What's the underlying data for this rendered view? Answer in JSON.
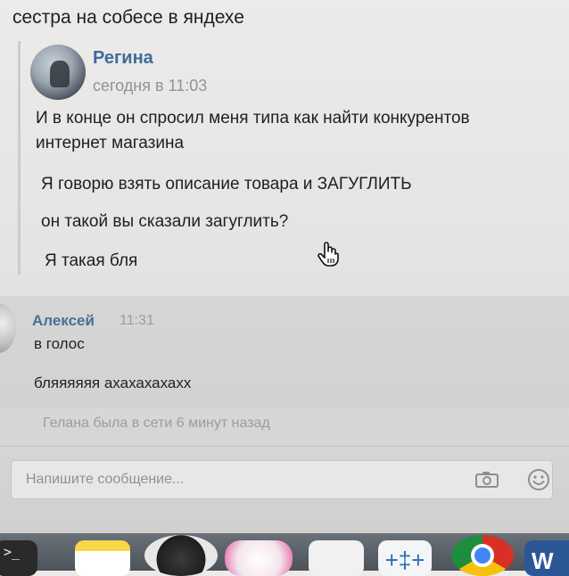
{
  "caption": "сестра на собесе в яндехе",
  "post": {
    "author": "Регина",
    "time": "сегодня в 11:03",
    "lines": [
      "И в конце он спросил меня типа как найти конкурентов",
      "интернет магазина",
      "Я говорю взять описание товара и ЗАГУГЛИТЬ",
      "он такой вы сказали загуглить?",
      "Я такая бля"
    ]
  },
  "reply": {
    "author": "Алексей",
    "time": "11:31",
    "lines": [
      "в голос",
      "бляяяяяя ахахахахахх"
    ]
  },
  "status": "Гелана была в сети 6 минут назад",
  "compose": {
    "placeholder": "Напишите сообщение...",
    "value": ""
  },
  "icons": {
    "camera": "camera-icon",
    "emoji": "smile-icon",
    "cursor": "pointing-hand-cursor-icon"
  },
  "dock": {
    "terminal_glyph": ">_",
    "tableau_glyph": "+‡+",
    "word_glyph": "W"
  },
  "colors": {
    "author_link": "#3e6a9a",
    "muted": "#8f9399",
    "dock": "#4d535a"
  }
}
